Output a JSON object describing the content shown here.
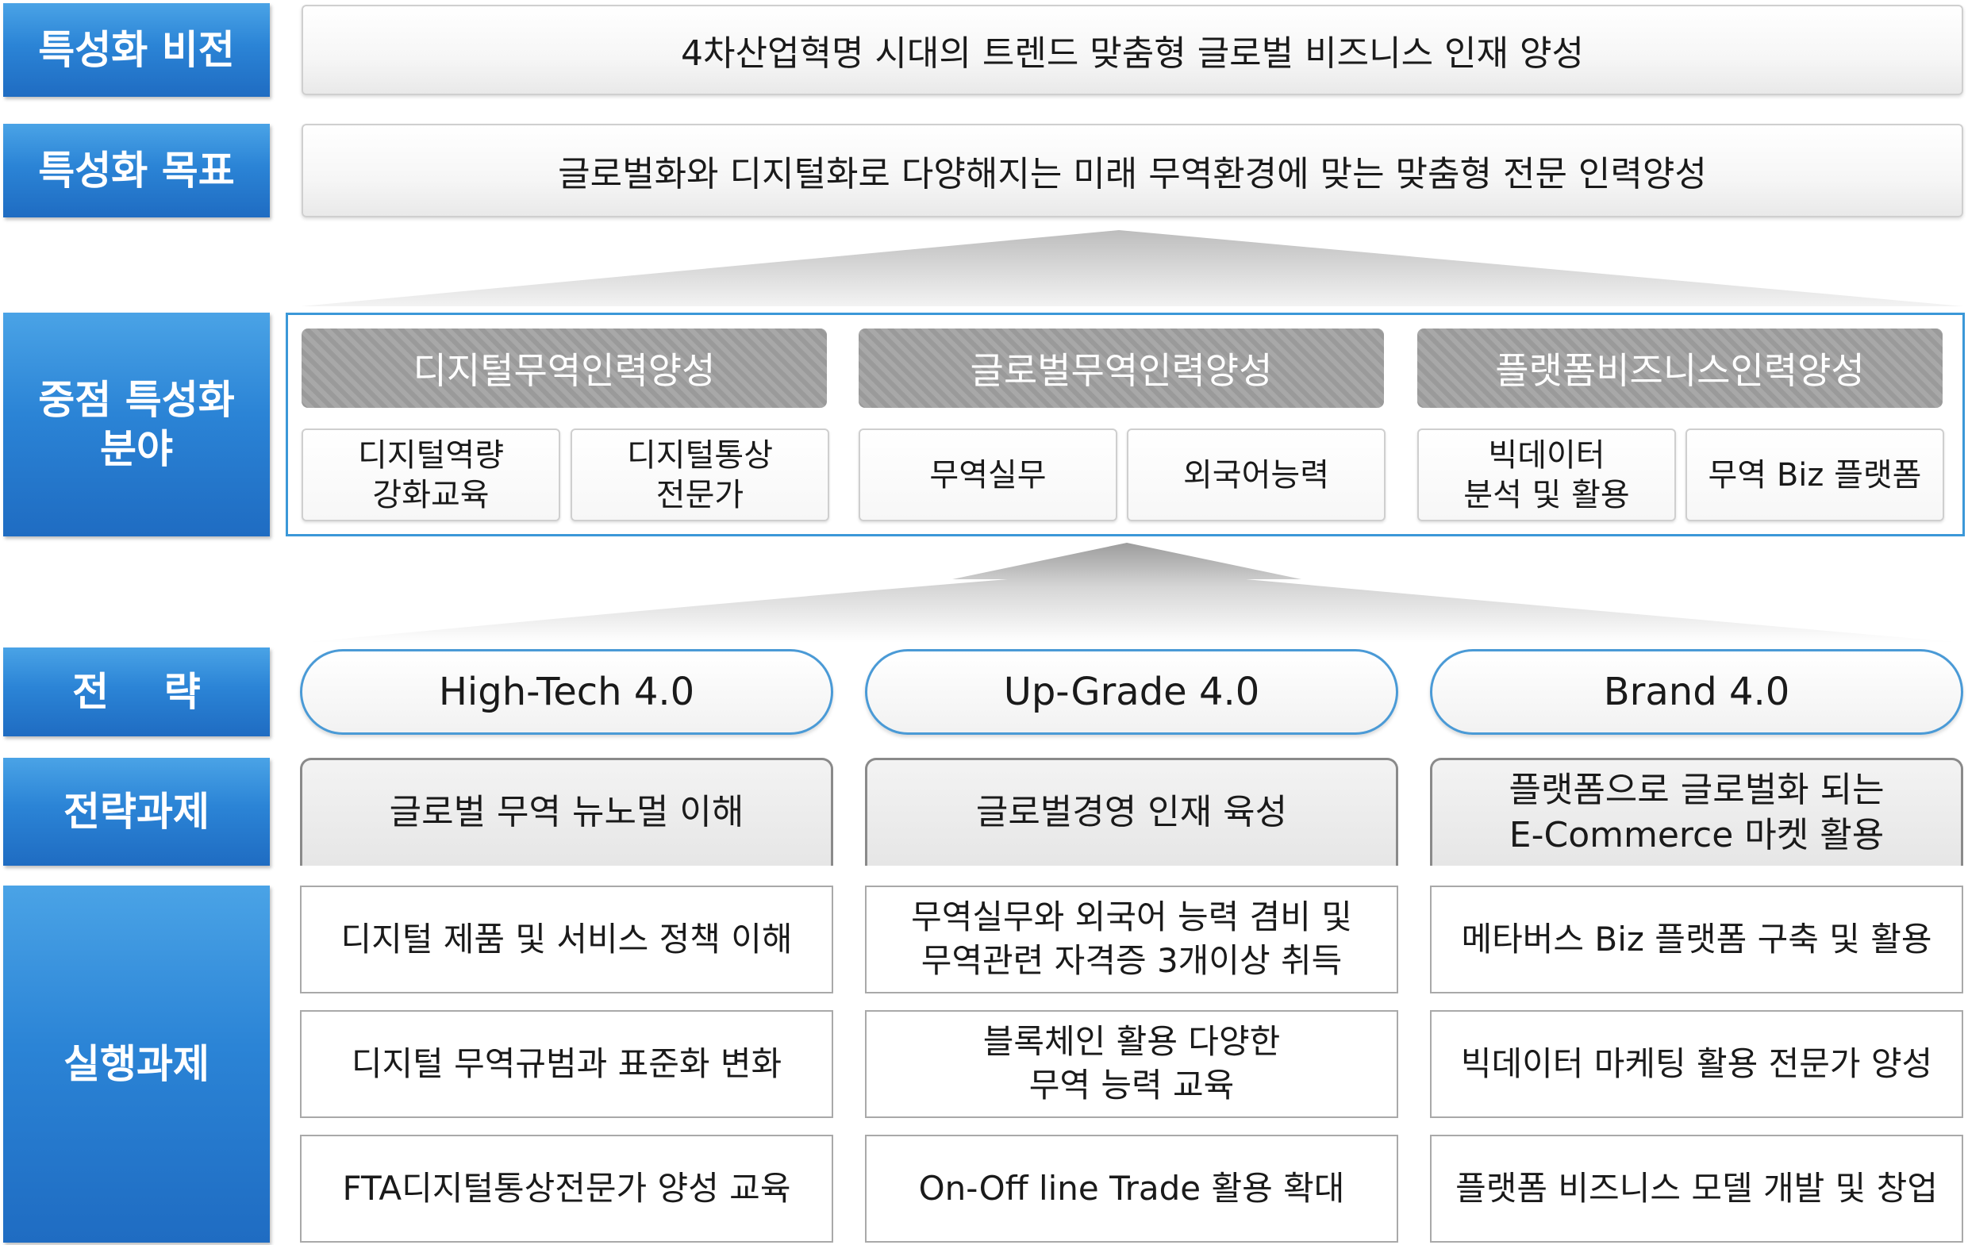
{
  "labels": {
    "vision": "특성화 비전",
    "goal": "특성화 목표",
    "focus_line1": "중점 특성화",
    "focus_line2": "분야",
    "strategy": "전    략",
    "strategy_tasks": "전략과제",
    "execution_tasks": "실행과제"
  },
  "vision_text": "4차산업혁명 시대의 트렌드 맞춤형 글로벌 비즈니스 인재 양성",
  "goal_text": "글로벌화와 디지털화로 다양해지는 미래 무역환경에 맞는 맞춤형 전문 인력양성",
  "focus_areas": [
    {
      "title": "디지털무역인력양성",
      "items": [
        [
          "디지털역량",
          "강화교육"
        ],
        [
          "디지털통상",
          "전문가"
        ]
      ]
    },
    {
      "title": "글로벌무역인력양성",
      "items": [
        [
          "무역실무"
        ],
        [
          "외국어능력"
        ]
      ]
    },
    {
      "title": "플랫폼비즈니스인력양성",
      "items": [
        [
          "빅데이터",
          "분석 및 활용"
        ],
        [
          "무역 Biz 플랫폼"
        ]
      ]
    }
  ],
  "strategies": [
    "High-Tech 4.0",
    "Up-Grade 4.0",
    "Brand 4.0"
  ],
  "strategy_tasks": [
    [
      "글로벌 무역 뉴노멀 이해"
    ],
    [
      "글로벌경영 인재 육성"
    ],
    [
      "플랫폼으로 글로벌화 되는",
      "E-Commerce 마켓 활용"
    ]
  ],
  "execution_tasks": [
    [
      [
        "디지털 제품 및 서비스 정책 이해"
      ],
      [
        "디지털 무역규범과 표준화 변화"
      ],
      [
        "FTA디지털통상전문가 양성 교육"
      ]
    ],
    [
      [
        "무역실무와 외국어 능력 겸비 및",
        "무역관련 자격증 3개이상 취득"
      ],
      [
        "블록체인 활용 다양한",
        "무역 능력 교육"
      ],
      [
        "On-Off line Trade 활용 확대"
      ]
    ],
    [
      [
        "메타버스 Biz 플랫폼 구축 및 활용"
      ],
      [
        "빅데이터 마케팅 활용 전문가 양성"
      ],
      [
        "플랫폼 비즈니스 모델 개발 및 창업"
      ]
    ]
  ],
  "colors": {
    "label_blue": "#2b84d6",
    "panel_border": "#3b98d8",
    "pill_border": "#4a9ad6"
  }
}
